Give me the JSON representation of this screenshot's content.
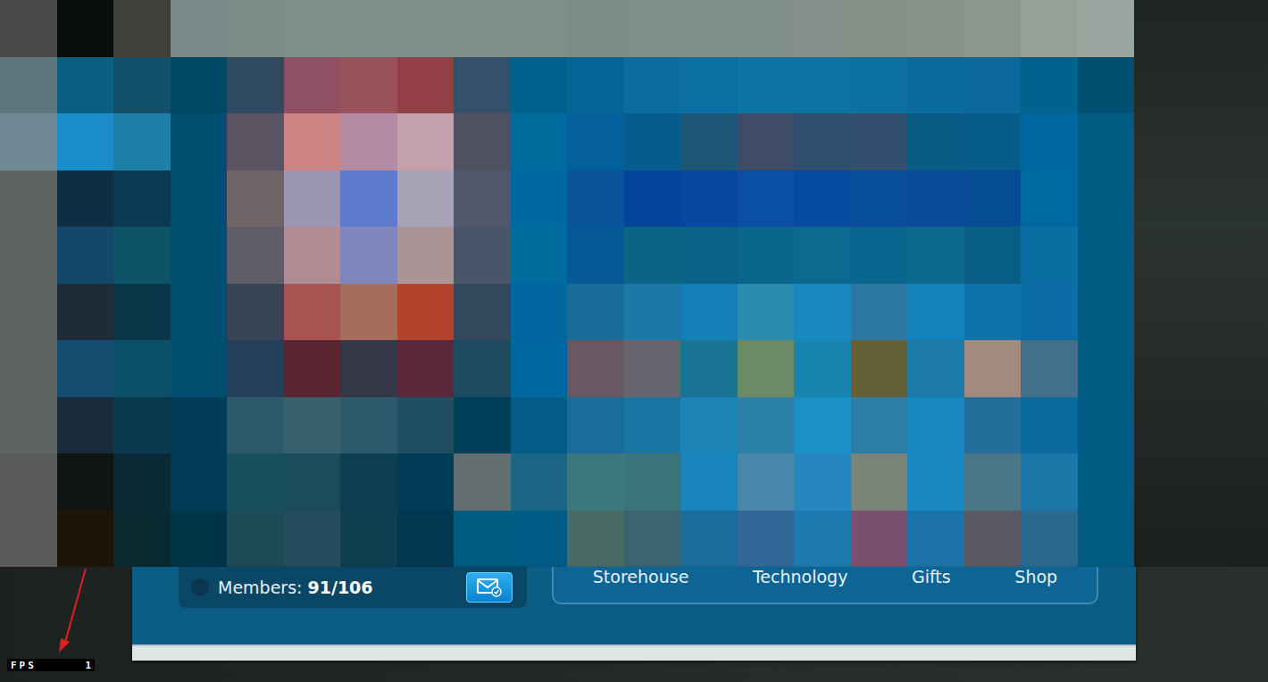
{
  "members": {
    "label": "Members:",
    "count": "91/106"
  },
  "tabs": [
    {
      "label": "Storehouse",
      "selected": false
    },
    {
      "label": "Technology",
      "selected": false
    },
    {
      "label": "Gifts",
      "selected": false
    },
    {
      "label": "Shop",
      "selected": false
    }
  ],
  "fps": {
    "label": "FPS",
    "value": "1"
  }
}
